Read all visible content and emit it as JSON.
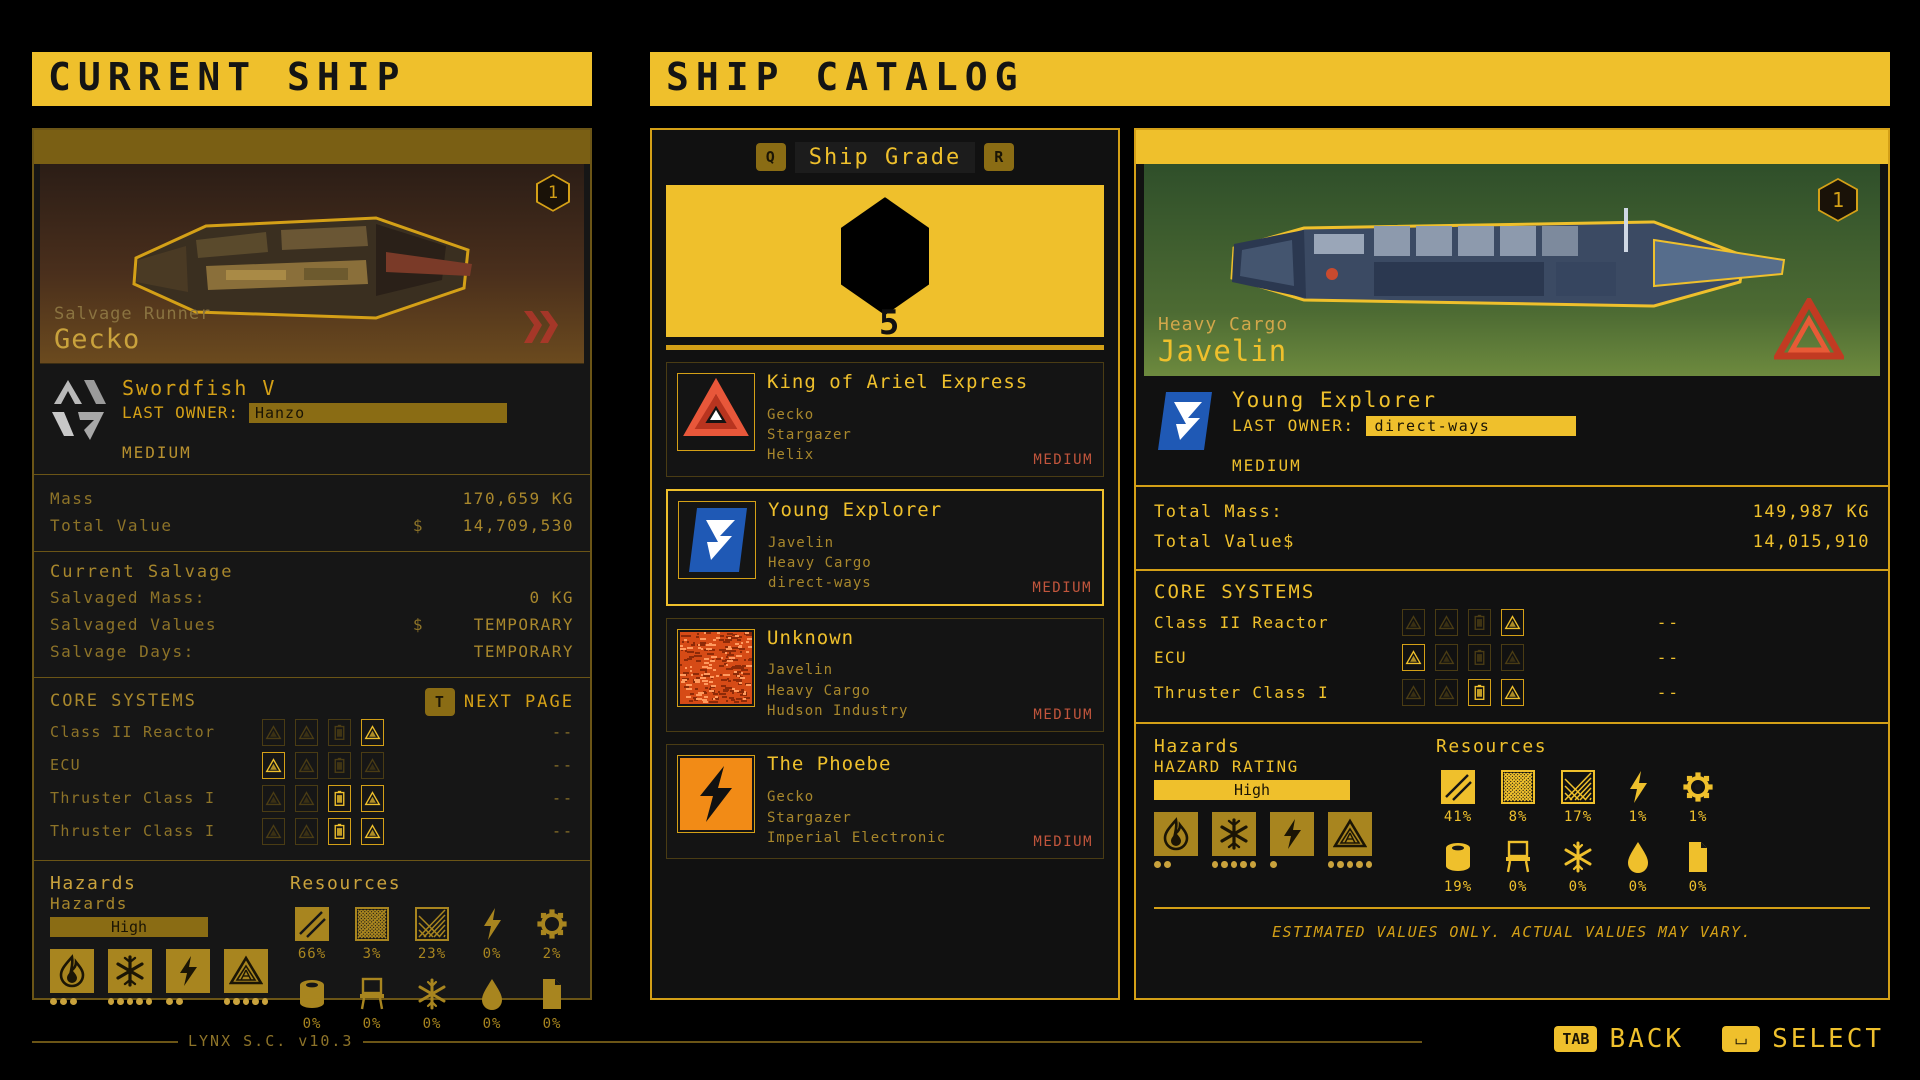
{
  "left_panel": {
    "header": "CURRENT SHIP",
    "badge": "1",
    "art_sub": "Salvage Runner",
    "art_name": "Gecko",
    "ship_name": "Swordfish V",
    "last_owner_label": "LAST OWNER:",
    "last_owner_value": "Hanzo",
    "size_class": "MEDIUM",
    "stats": [
      {
        "label": "Mass",
        "currency": "",
        "value": "170,659 KG"
      },
      {
        "label": "Total Value",
        "currency": "$",
        "value": "14,709,530"
      }
    ],
    "salvage_title": "Current Salvage",
    "salvage": [
      {
        "label": "Salvaged Mass:",
        "currency": "",
        "value": "0 KG"
      },
      {
        "label": "Salvaged Values",
        "currency": "$",
        "value": "TEMPORARY"
      },
      {
        "label": "Salvage Days:",
        "currency": "",
        "value": "TEMPORARY"
      }
    ],
    "core_title": "CORE SYSTEMS",
    "next_page_key": "T",
    "next_page_label": "NEXT PAGE",
    "core_systems": [
      {
        "name": "Class II Reactor",
        "slots": [
          "off-tri",
          "off-tri",
          "off-bat",
          "on-tri"
        ],
        "value": "--"
      },
      {
        "name": "ECU",
        "slots": [
          "on-tri",
          "off-tri",
          "off-bat",
          "off-tri"
        ],
        "value": "--"
      },
      {
        "name": "Thruster Class I",
        "slots": [
          "off-tri",
          "off-tri",
          "on-bat",
          "on-tri"
        ],
        "value": "--"
      },
      {
        "name": "Thruster Class I",
        "slots": [
          "off-tri",
          "off-tri",
          "on-bat",
          "on-tri"
        ],
        "value": "--"
      }
    ],
    "hazards_title": "Hazards",
    "hazards_sub": "Hazards",
    "hazard_rating": "High",
    "hazards": [
      {
        "icon": "fire-icon",
        "dots": 3
      },
      {
        "icon": "snowflake-icon",
        "dots": 5
      },
      {
        "icon": "lightning-icon",
        "dots": 2
      },
      {
        "icon": "radiation-icon",
        "dots": 5
      }
    ],
    "resources_title": "Resources",
    "resources": [
      {
        "icon": "metal-plate-icon",
        "pct": "66%"
      },
      {
        "icon": "mesh-icon",
        "pct": "3%"
      },
      {
        "icon": "glass-icon",
        "pct": "23%"
      },
      {
        "icon": "lightning-icon",
        "pct": "0%"
      },
      {
        "icon": "gear-icon",
        "pct": "2%"
      },
      {
        "icon": "barrel-icon",
        "pct": "0%"
      },
      {
        "icon": "chair-icon",
        "pct": "0%"
      },
      {
        "icon": "snowflake-icon",
        "pct": "0%"
      },
      {
        "icon": "droplet-icon",
        "pct": "0%"
      },
      {
        "icon": "document-icon",
        "pct": "0%"
      }
    ]
  },
  "catalog": {
    "header": "SHIP CATALOG",
    "prev_key": "Q",
    "next_key": "R",
    "grade_label": "Ship Grade",
    "grade_value": "5",
    "items": [
      {
        "name": "King of Ariel Express",
        "logo": "triangle-knot-logo",
        "meta": [
          "Gecko",
          "Stargazer",
          "Helix"
        ],
        "class": "MEDIUM",
        "selected": false
      },
      {
        "name": "Young Explorer",
        "logo": "blue-flag-logo",
        "meta": [
          "Javelin",
          "Heavy Cargo",
          "direct-ways"
        ],
        "class": "MEDIUM",
        "selected": true
      },
      {
        "name": "Unknown",
        "logo": "static-noise-logo",
        "meta": [
          "Javelin",
          "Heavy Cargo",
          "Hudson Industry"
        ],
        "class": "MEDIUM",
        "selected": false
      },
      {
        "name": "The Phoebe",
        "logo": "orange-bolt-logo",
        "meta": [
          "Gecko",
          "Stargazer",
          "Imperial Electronic"
        ],
        "class": "MEDIUM",
        "selected": false
      }
    ]
  },
  "detail": {
    "badge": "1",
    "art_sub": "Heavy Cargo",
    "art_name": "Javelin",
    "ship_name": "Young Explorer",
    "last_owner_label": "LAST OWNER:",
    "last_owner_value": "direct-ways",
    "size_class": "MEDIUM",
    "stats": [
      {
        "label": "Total Mass:",
        "value": "149,987 KG"
      },
      {
        "label": "Total Value$",
        "value": "14,015,910"
      }
    ],
    "core_title": "CORE SYSTEMS",
    "core_systems": [
      {
        "name": "Class II Reactor",
        "slots": [
          "off-tri",
          "off-tri",
          "off-bat",
          "on-tri"
        ],
        "value": "--"
      },
      {
        "name": "ECU",
        "slots": [
          "on-tri",
          "off-tri",
          "off-bat",
          "off-tri"
        ],
        "value": "--"
      },
      {
        "name": "Thruster Class I",
        "slots": [
          "off-tri",
          "off-tri",
          "on-bat",
          "on-tri"
        ],
        "value": "--"
      }
    ],
    "hazards_title": "Hazards",
    "hazard_rating_label": "HAZARD RATING",
    "hazard_rating": "High",
    "hazards": [
      {
        "icon": "fire-icon",
        "dots": 2
      },
      {
        "icon": "snowflake-icon",
        "dots": 5
      },
      {
        "icon": "lightning-icon",
        "dots": 1
      },
      {
        "icon": "radiation-icon",
        "dots": 5
      }
    ],
    "resources_title": "Resources",
    "resources": [
      {
        "icon": "metal-plate-icon",
        "pct": "41%"
      },
      {
        "icon": "mesh-icon",
        "pct": "8%"
      },
      {
        "icon": "glass-icon",
        "pct": "17%"
      },
      {
        "icon": "lightning-icon",
        "pct": "1%"
      },
      {
        "icon": "gear-icon",
        "pct": "1%"
      },
      {
        "icon": "barrel-icon",
        "pct": "19%"
      },
      {
        "icon": "chair-icon",
        "pct": "0%"
      },
      {
        "icon": "snowflake-icon",
        "pct": "0%"
      },
      {
        "icon": "droplet-icon",
        "pct": "0%"
      },
      {
        "icon": "document-icon",
        "pct": "0%"
      }
    ],
    "footnote": "ESTIMATED VALUES ONLY. ACTUAL VALUES MAY VARY."
  },
  "footer": {
    "version": "LYNX S.C. v10.3",
    "back_key": "TAB",
    "back_label": "BACK",
    "select_key": "⌴",
    "select_label": "SELECT"
  },
  "colors": {
    "accent": "#efc02c",
    "amber": "#d4a017",
    "dim_amber": "#6b5516",
    "background": "#000000",
    "panel": "#111111",
    "class_text": "#c1553c"
  }
}
